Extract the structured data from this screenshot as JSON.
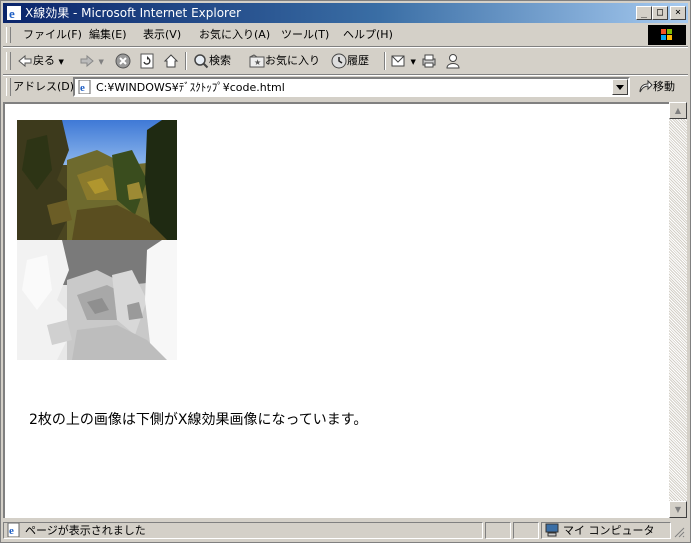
{
  "window": {
    "title": "X線効果 - Microsoft Internet Explorer",
    "caption_buttons": {
      "minimize": "_",
      "maximize": "□",
      "close": "×"
    }
  },
  "menu": {
    "items": [
      "ファイル(F)",
      "編集(E)",
      "表示(V)",
      "お気に入り(A)",
      "ツール(T)",
      "ヘルプ(H)"
    ]
  },
  "toolbar": {
    "back": "戻る",
    "search": "検索",
    "favorites": "お気に入り",
    "history": "履歴"
  },
  "address": {
    "label": "アドレス(D)",
    "value": "C:¥WINDOWS¥ﾃﾞｽｸﾄｯﾌﾟ¥code.html",
    "go": "移動"
  },
  "content": {
    "text": "2枚の上の画像は下側がX線効果画像になっています。"
  },
  "status": {
    "message": "ページが表示されました",
    "zone": "マイ コンピュータ"
  }
}
